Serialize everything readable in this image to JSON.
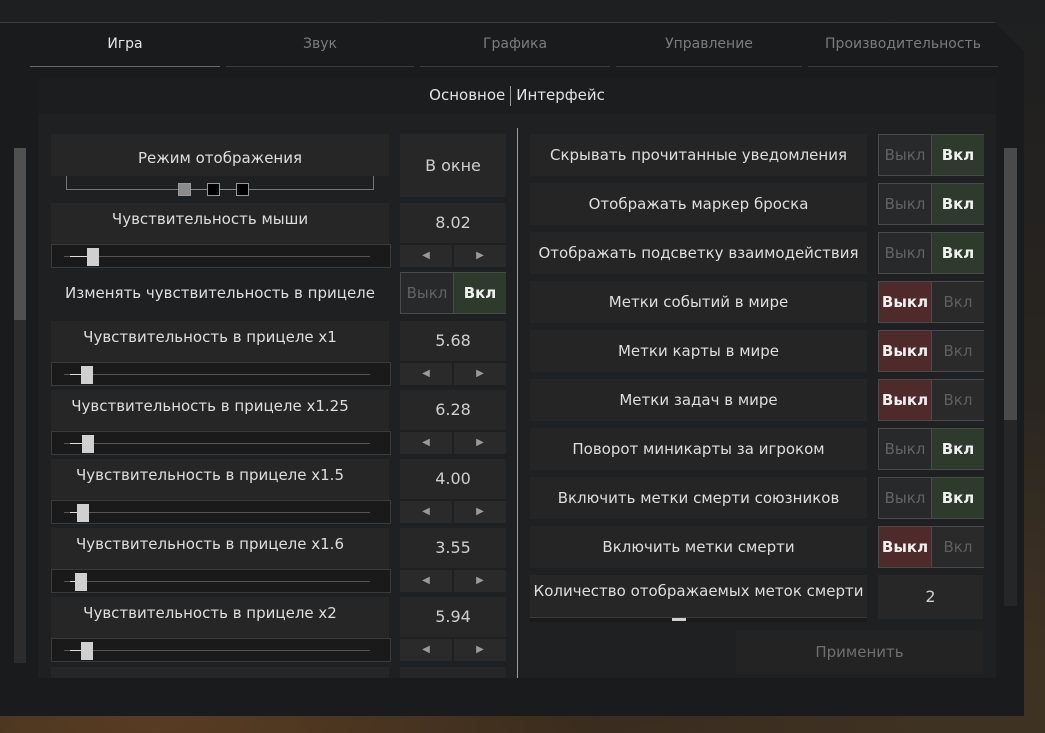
{
  "tabs": [
    {
      "label": "Игра",
      "active": true
    },
    {
      "label": "Звук",
      "active": false
    },
    {
      "label": "Графика",
      "active": false
    },
    {
      "label": "Управление",
      "active": false
    },
    {
      "label": "Производительность",
      "active": false
    }
  ],
  "subtabs": {
    "left": "Основное",
    "right": "Интерфейс"
  },
  "display_mode": {
    "label": "Режим отображения",
    "value": "В окне",
    "options_count": 3,
    "selected_index": 0
  },
  "mouse_sens": {
    "label": "Чувствительность мыши",
    "value": "8.02",
    "fraction": 0.08
  },
  "scope_toggle": {
    "label": "Изменять чувствительность в прицеле",
    "off": "Выкл",
    "on": "Вкл",
    "state": "on"
  },
  "scope_sens": [
    {
      "label": "Чувствительность в прицеле x1",
      "value": "5.68",
      "fraction": 0.05
    },
    {
      "label": "Чувствительность в прицеле x1.25",
      "value": "6.28",
      "fraction": 0.055
    },
    {
      "label": "Чувствительность в прицеле x1.5",
      "value": "4.00",
      "fraction": 0.03
    },
    {
      "label": "Чувствительность в прицеле x1.6",
      "value": "3.55",
      "fraction": 0.025
    },
    {
      "label": "Чувствительность в прицеле x2",
      "value": "5.94",
      "fraction": 0.05
    }
  ],
  "arrows": {
    "left": "◀",
    "right": "▶"
  },
  "right_rows": [
    {
      "label": "Скрывать прочитанные уведомления",
      "state": "on"
    },
    {
      "label": "Отображать маркер броска",
      "state": "on"
    },
    {
      "label": "Отображать подсветку взаимодействия",
      "state": "on"
    },
    {
      "label": "Метки событий в мире",
      "state": "off"
    },
    {
      "label": "Метки карты в мире",
      "state": "off"
    },
    {
      "label": "Метки задач в мире",
      "state": "off"
    },
    {
      "label": "Поворот миникарты за игроком",
      "state": "on"
    },
    {
      "label": "Включить метки смерти союзников",
      "state": "on"
    },
    {
      "label": "Включить метки смерти",
      "state": "off"
    }
  ],
  "toggle_text": {
    "off": "Выкл",
    "on": "Вкл"
  },
  "death_marks": {
    "label": "Количество отображаемых меток смерти",
    "value": "2"
  },
  "apply": "Применить",
  "colors": {
    "on_bg": "#2d3a2c",
    "off_bg": "#4f2a2b",
    "panel": "#1f2021"
  }
}
